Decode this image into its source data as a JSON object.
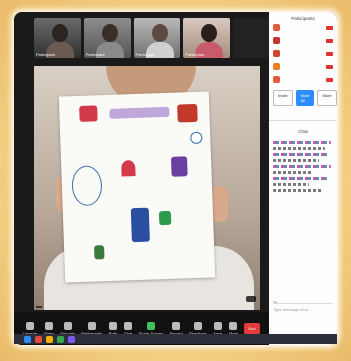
{
  "meeting": {
    "gallery": [
      {
        "name": "Participant",
        "style": "t1"
      },
      {
        "name": "Participant",
        "style": "t2"
      },
      {
        "name": "Participant",
        "style": "t3"
      },
      {
        "name": "Participant",
        "style": "t4"
      }
    ],
    "speaker_label": "",
    "speaker_hint": ""
  },
  "toolbar": {
    "items": [
      "Unmute",
      "Video",
      "Security",
      "Participants",
      "Polls",
      "Chat",
      "Share Screen",
      "Record",
      "Reactions",
      "Apps",
      "More"
    ],
    "end_label": "End"
  },
  "panel": {
    "participants_title": "Participants",
    "participants": [
      {
        "name": "",
        "color": "#e05a3c"
      },
      {
        "name": "",
        "color": "#c0392b"
      },
      {
        "name": "",
        "color": "#d1462f"
      },
      {
        "name": "",
        "color": "#e67e22"
      },
      {
        "name": "",
        "color": "#e05a3c"
      }
    ],
    "buttons": [
      "Invite",
      "Mute All",
      "More"
    ],
    "chat_title": "Chat",
    "chat_to_label": "To:",
    "chat_placeholder": "Type message here..."
  }
}
